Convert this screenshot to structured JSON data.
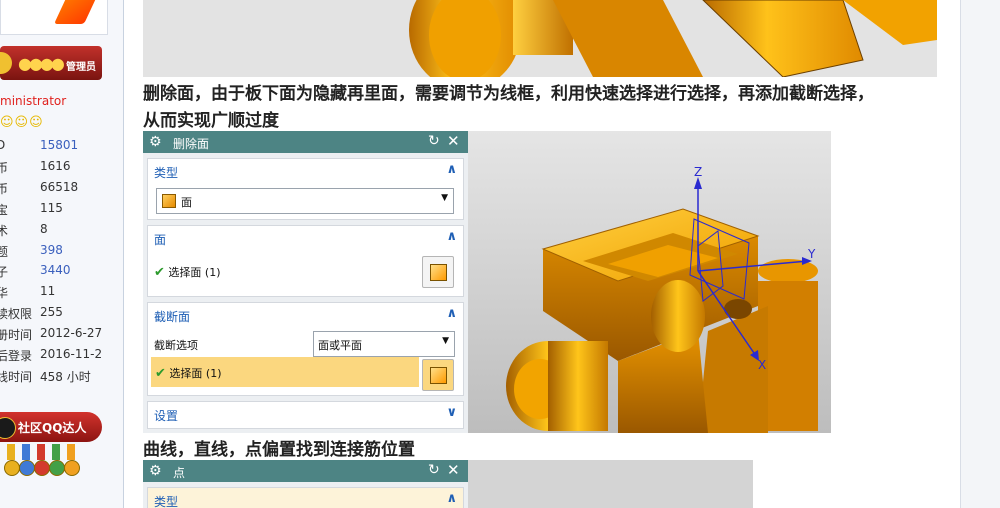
{
  "sidebar": {
    "admin_badge": "管理员",
    "username": "ministrator",
    "smileys": "☺☺☺",
    "stats": [
      {
        "key": "D",
        "value": "15801",
        "link": true
      },
      {
        "key": "币",
        "value": "1616",
        "link": false
      },
      {
        "key": "币",
        "value": "66518",
        "link": false
      },
      {
        "key": "宝",
        "value": "115",
        "link": false
      },
      {
        "key": "术",
        "value": "8",
        "link": false
      },
      {
        "key": "题",
        "value": "398",
        "link": true
      },
      {
        "key": "子",
        "value": "3440",
        "link": true
      },
      {
        "key": "华",
        "value": "11",
        "link": false
      },
      {
        "key": "读权限",
        "value": "255",
        "link": false
      },
      {
        "key": "册时间",
        "value": "2012-6-27",
        "link": false
      },
      {
        "key": "后登录",
        "value": "2016-11-2",
        "link": false
      },
      {
        "key": "线时间",
        "value": "458 小时",
        "link": false
      }
    ],
    "qq_badge": "社区QQ达人",
    "medal_colors": [
      "#e8b020",
      "#3f7ad6",
      "#d33a2c",
      "#43a047",
      "#f0a020"
    ]
  },
  "post": {
    "heading1": "删除面，由于板下面为隐藏再里面，需要调节为线框，利用快速选择进行选择，再添加截断选择，",
    "heading1_line2": "从而实现广顺过度",
    "heading2": "曲线，直线，点偏置找到连接筋位置"
  },
  "dialog_delete_face": {
    "title": "删除面",
    "type_section": "类型",
    "type_value": "面",
    "face_section": "面",
    "select_face": "选择面 (1)",
    "cutoff_section": "截断面",
    "cutoff_option_label": "截断选项",
    "cutoff_option_value": "面或平面",
    "select_face_2": "选择面 (1)",
    "settings_section": "设置"
  },
  "axes": {
    "z": "Z",
    "y": "Y",
    "x": "X"
  },
  "dialog_point": {
    "title": "点",
    "type_section": "类型"
  },
  "colors": {
    "dialog_title": "#4d8484",
    "section_header": "#1f5fb5",
    "part_orange": "#f5a300",
    "highlight": "#fbd77f"
  }
}
